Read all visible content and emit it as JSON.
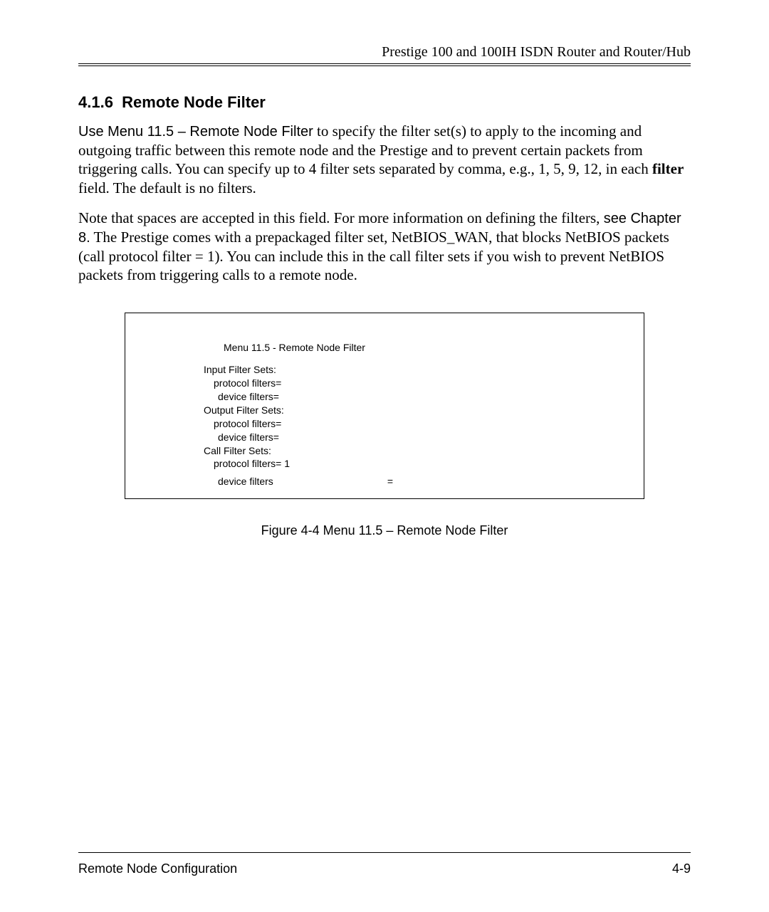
{
  "header": {
    "text": "Prestige 100 and 100IH ISDN Router and Router/Hub"
  },
  "section": {
    "number": "4.1.6",
    "title": "Remote Node Filter"
  },
  "para1": {
    "lead_sans": "Use Menu 11.5 – Remote Node Filter",
    "rest": " to specify the filter set(s) to apply to the incoming and outgoing traffic between this remote node and the Prestige and to prevent certain packets from triggering calls. You can specify up to 4 filter sets separated by comma, e.g., 1, 5, 9, 12, in each ",
    "bold": "filter",
    "tail": " field. The default is no filters."
  },
  "para2": {
    "part1": "Note that spaces are accepted in this field.  For more information on defining the filters, ",
    "sans": "see Chapter 8.",
    "part2": " The Prestige comes with a prepackaged filter set, NetBIOS_WAN, that blocks NetBIOS packets (call protocol filter = 1).  You can include this in the call filter sets if you wish to prevent NetBIOS packets from triggering calls to a remote node."
  },
  "figure": {
    "title": "Menu 11.5 - Remote Node Filter",
    "lines": {
      "l1": "Input Filter Sets:",
      "l2": "protocol filters=",
      "l3": "device filters=",
      "l4": "Output Filter Sets:",
      "l5": "protocol filters=",
      "l6": "device filters=",
      "l7": "Call Filter Sets:",
      "l8": "protocol filters= 1",
      "l9a": "device filters",
      "l9b": "="
    },
    "caption": "Figure  4-4 Menu 11.5 – Remote Node Filter"
  },
  "footer": {
    "left": "Remote Node Configuration",
    "right": "4-9"
  }
}
